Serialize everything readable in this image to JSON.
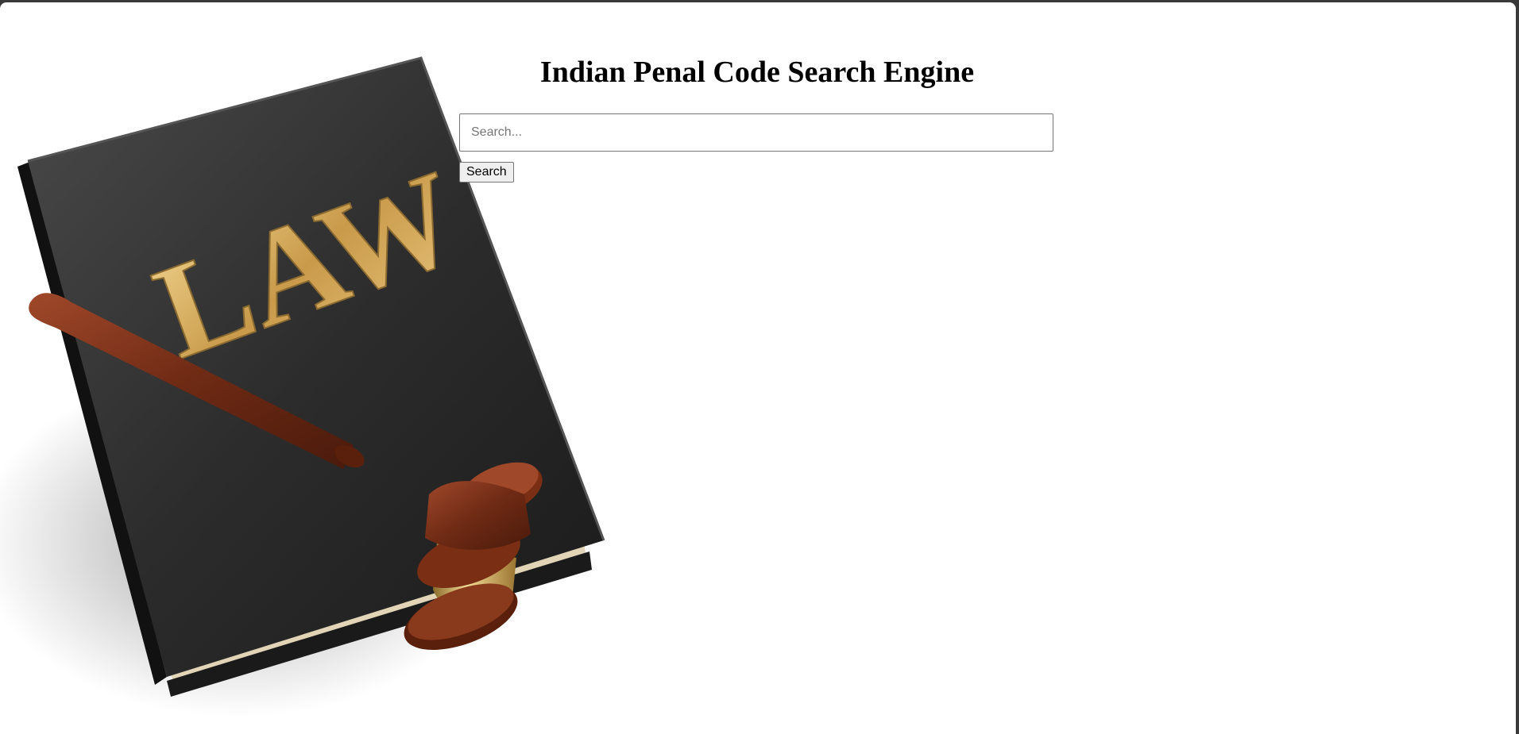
{
  "page": {
    "title": "Indian Penal Code Search Engine"
  },
  "search": {
    "placeholder": "Search...",
    "value": "",
    "button_label": "Search"
  },
  "hero_image": {
    "book_cover_text": "LAW",
    "book_color": "#2b2b2b",
    "lettering_color": "#d8b56a",
    "gavel_color": "#7a2e14",
    "gavel_band_color": "#d9b35a"
  }
}
